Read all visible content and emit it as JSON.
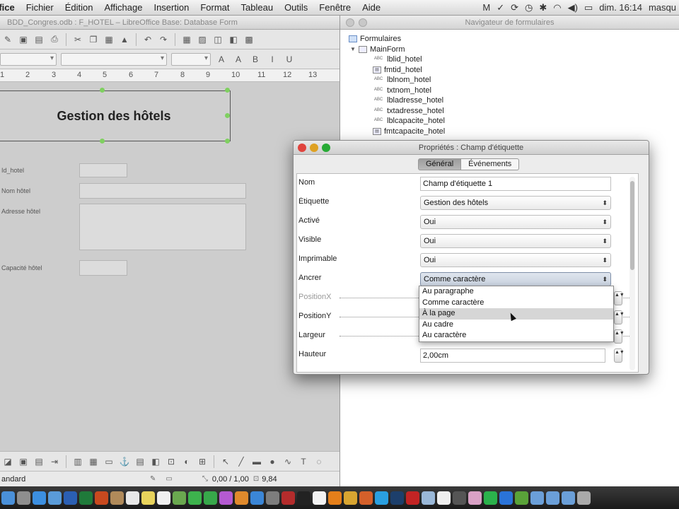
{
  "menubar": {
    "app_name": "ffice",
    "items": [
      "Fichier",
      "Édition",
      "Affichage",
      "Insertion",
      "Format",
      "Tableau",
      "Outils",
      "Fenêtre",
      "Aide"
    ],
    "clock": "dim. 16:14",
    "user": "masqu"
  },
  "lo_window": {
    "title": "BDD_Congres.odb : F_HOTEL – LibreOffice Base: Database Form",
    "ruler_marks": [
      "1",
      "2",
      "3",
      "4",
      "5",
      "6",
      "7",
      "8",
      "9",
      "10",
      "11",
      "12",
      "13"
    ],
    "form": {
      "title_label": "Gestion des hôtels",
      "field_labels": [
        "Id_hotel",
        "Nom hôtel",
        "Adresse hôtel",
        "Capacité hôtel"
      ]
    },
    "statusbar": {
      "style": "andard",
      "position": "0,00 / 1,00",
      "size": "9,84"
    }
  },
  "navigator": {
    "title": "Navigateur de formulaires",
    "root": "Formulaires",
    "main_form": "MainForm",
    "controls": [
      {
        "label": "lblid_hotel",
        "type": "abc"
      },
      {
        "label": "fmtid_hotel",
        "type": "field"
      },
      {
        "label": "lblnom_hotel",
        "type": "abc"
      },
      {
        "label": "txtnom_hotel",
        "type": "abc"
      },
      {
        "label": "lbladresse_hotel",
        "type": "abc"
      },
      {
        "label": "txtadresse_hotel",
        "type": "abc"
      },
      {
        "label": "lblcapacite_hotel",
        "type": "abc"
      },
      {
        "label": "fmtcapacite_hotel",
        "type": "field"
      }
    ]
  },
  "properties": {
    "title": "Propriétés : Champ d'étiquette",
    "tabs": [
      "Général",
      "Événements"
    ],
    "rows": [
      {
        "label": "Nom",
        "value": "Champ d'étiquette 1"
      },
      {
        "label": "Étiquette",
        "value": "Gestion des hôtels"
      },
      {
        "label": "Activé",
        "value": "Oui"
      },
      {
        "label": "Visible",
        "value": "Oui"
      },
      {
        "label": "Imprimable",
        "value": "Oui"
      },
      {
        "label": "Ancrer",
        "value": "Comme caractère"
      },
      {
        "label": "PositionX",
        "value": ""
      },
      {
        "label": "PositionY",
        "value": ""
      },
      {
        "label": "Largeur",
        "value": ""
      },
      {
        "label": "Hauteur",
        "value": "2,00cm"
      }
    ],
    "anchor_options": [
      "Au paragraphe",
      "Comme caractère",
      "À la page",
      "Au cadre",
      "Au caractère"
    ],
    "highlighted_option": "À la page"
  },
  "colors": {
    "selection_handle": "#7fd060",
    "dropdown_hover": "#d6d6d6",
    "dialog_close": "#e0443e",
    "dialog_min": "#dea123",
    "dialog_max": "#27aa35"
  }
}
